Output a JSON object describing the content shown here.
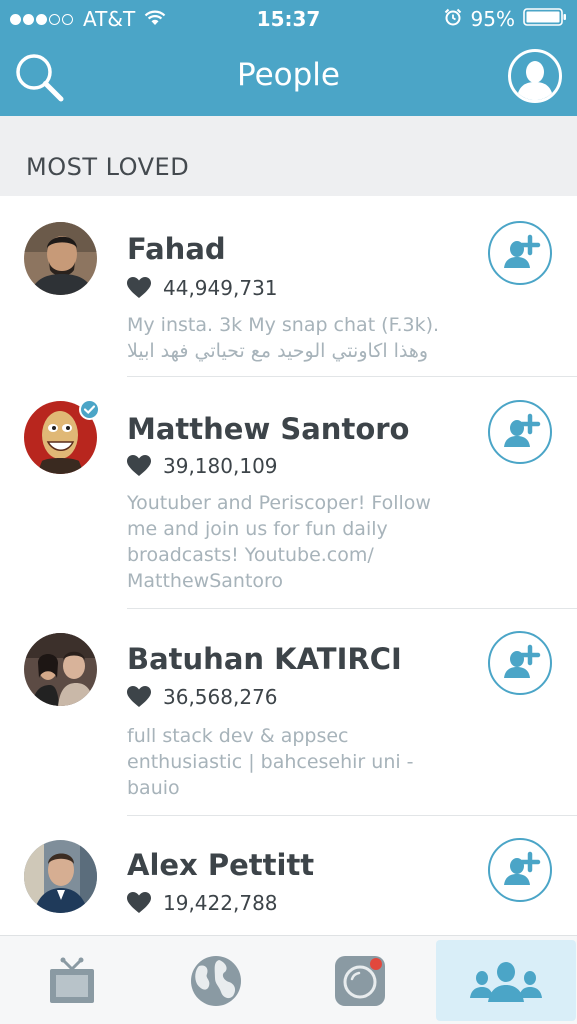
{
  "status_bar": {
    "carrier": "AT&T",
    "time": "15:37",
    "battery": "95%"
  },
  "nav": {
    "title": "People"
  },
  "section": {
    "title": "MOST LOVED"
  },
  "people": [
    {
      "name": "Fahad",
      "hearts": "44,949,731",
      "bio": [
        "My insta. 3k My snap chat (F.3k).",
        "وهذا اكاونتي الوحيد مع تحياتي فهد ابيلا"
      ],
      "verified": false
    },
    {
      "name": "Matthew Santoro",
      "hearts": "39,180,109",
      "bio": [
        "Youtuber and Periscoper! Follow",
        "me and join us for fun daily",
        "broadcasts! Youtube.com/",
        "MatthewSantoro"
      ],
      "verified": true
    },
    {
      "name": "Batuhan KATIRCI",
      "hearts": "36,568,276",
      "bio": [
        "full stack dev & appsec",
        "enthusiastic | bahcesehir uni -",
        "bauio"
      ],
      "verified": false
    },
    {
      "name": "Alex Pettitt",
      "hearts": "19,422,788",
      "bio": [],
      "verified": false
    }
  ],
  "tabs": [
    {
      "icon": "tv-icon",
      "active": false
    },
    {
      "icon": "globe-icon",
      "active": false
    },
    {
      "icon": "camera-icon",
      "active": false
    },
    {
      "icon": "people-group-icon",
      "active": true
    }
  ],
  "colors": {
    "accent": "#4ba5c7",
    "name_text": "#3d4449",
    "bio_text": "#a7b3ba",
    "section_bg": "#eeeff1",
    "active_tab_bg": "#d9eef8"
  }
}
